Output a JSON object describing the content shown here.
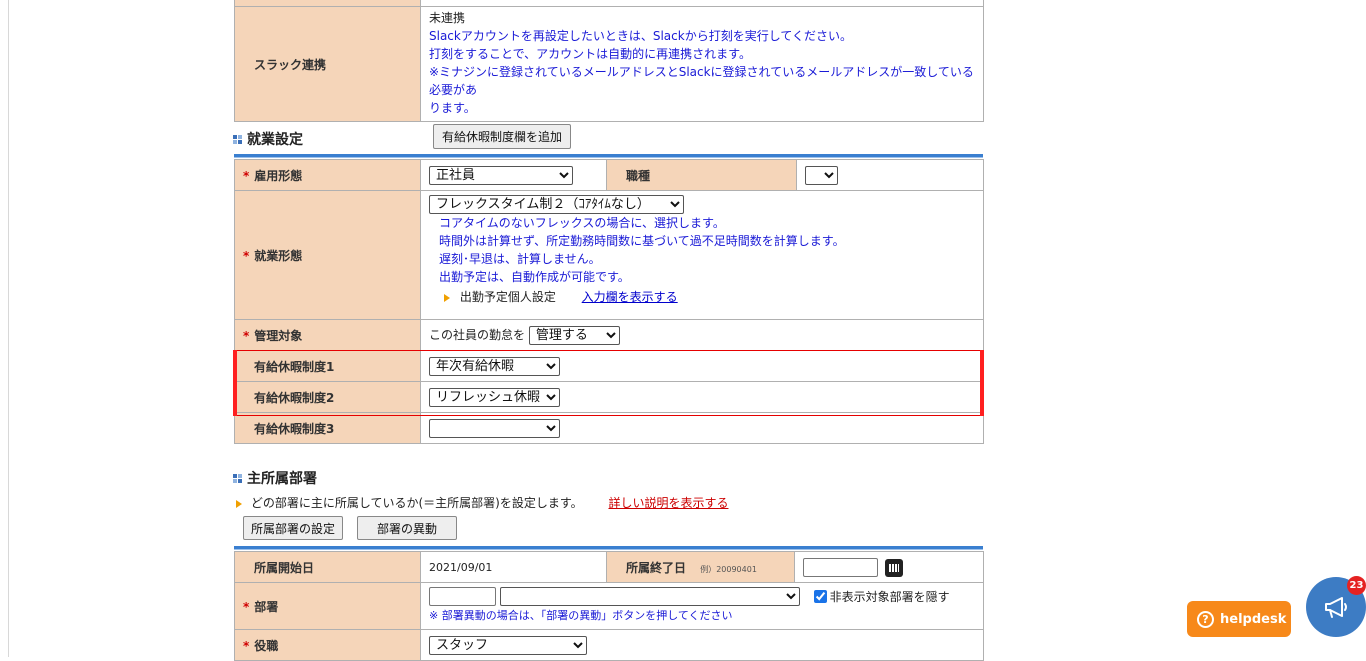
{
  "slack": {
    "label": "スラック連携",
    "status": "未連携",
    "line1": "Slackアカウントを再設定したいときは、Slackから打刻を実行してください。",
    "line2": "打刻をすることで、アカウントは自動的に再連携されます。",
    "line3": "※ミナジンに登録されているメールアドレスとSlackに登録されているメールアドレスが一致している必要があ",
    "line4": "ります。"
  },
  "work_section": {
    "title": "就業設定",
    "add_button": "有給休暇制度欄を追加",
    "employment_type_label": "雇用形態",
    "employment_type_value": "正社員",
    "job_type_label": "職種",
    "job_type_value": "",
    "work_style_label": "就業形態",
    "work_style_value": "フレックスタイム制２（ｺｱﾀｲﾑなし）",
    "desc1": "コアタイムのないフレックスの場合に、選択します。",
    "desc2": "時間外は計算せず、所定勤務時間数に基づいて過不足時間数を計算します。",
    "desc3": "遅刻･早退は、計算しません。",
    "desc4": "出勤予定は、自動作成が可能です。",
    "schedule_label": "出勤予定個人設定",
    "schedule_link": "入力欄を表示する",
    "manage_label": "管理対象",
    "manage_prefix": "この社員の勤怠を",
    "manage_value": "管理する",
    "leave1_label": "有給休暇制度1",
    "leave1_value": "年次有給休暇",
    "leave2_label": "有給休暇制度2",
    "leave2_value": "リフレッシュ休暇",
    "leave3_label": "有給休暇制度3",
    "leave3_value": ""
  },
  "dept_section": {
    "title": "主所属部署",
    "note": "どの部署に主に所属しているか(＝主所属部署)を設定します。",
    "detail_link": "詳しい説明を表示する",
    "set_button": "所属部署の設定",
    "transfer_button": "部署の異動",
    "start_label": "所属開始日",
    "start_value": "2021/09/01",
    "end_label": "所属終了日",
    "end_example": "例）20090401",
    "end_value": "",
    "dept_label": "部署",
    "dept_code": "",
    "dept_value": "",
    "hide_label": "非表示対象部署を隠す",
    "hide_checked": true,
    "dept_note": "※ 部署異動の場合は、「部署の異動」ボタンを押してください",
    "role_label": "役職",
    "role_value": "スタッフ"
  },
  "widgets": {
    "helpdesk_label": "helpdesk",
    "badge_count": "23"
  },
  "colors": {
    "label_bg": "#f5d5b9",
    "accent_blue": "#3a7fd0",
    "highlight_red": "#e60000",
    "helpdesk_orange": "#f7891a"
  }
}
